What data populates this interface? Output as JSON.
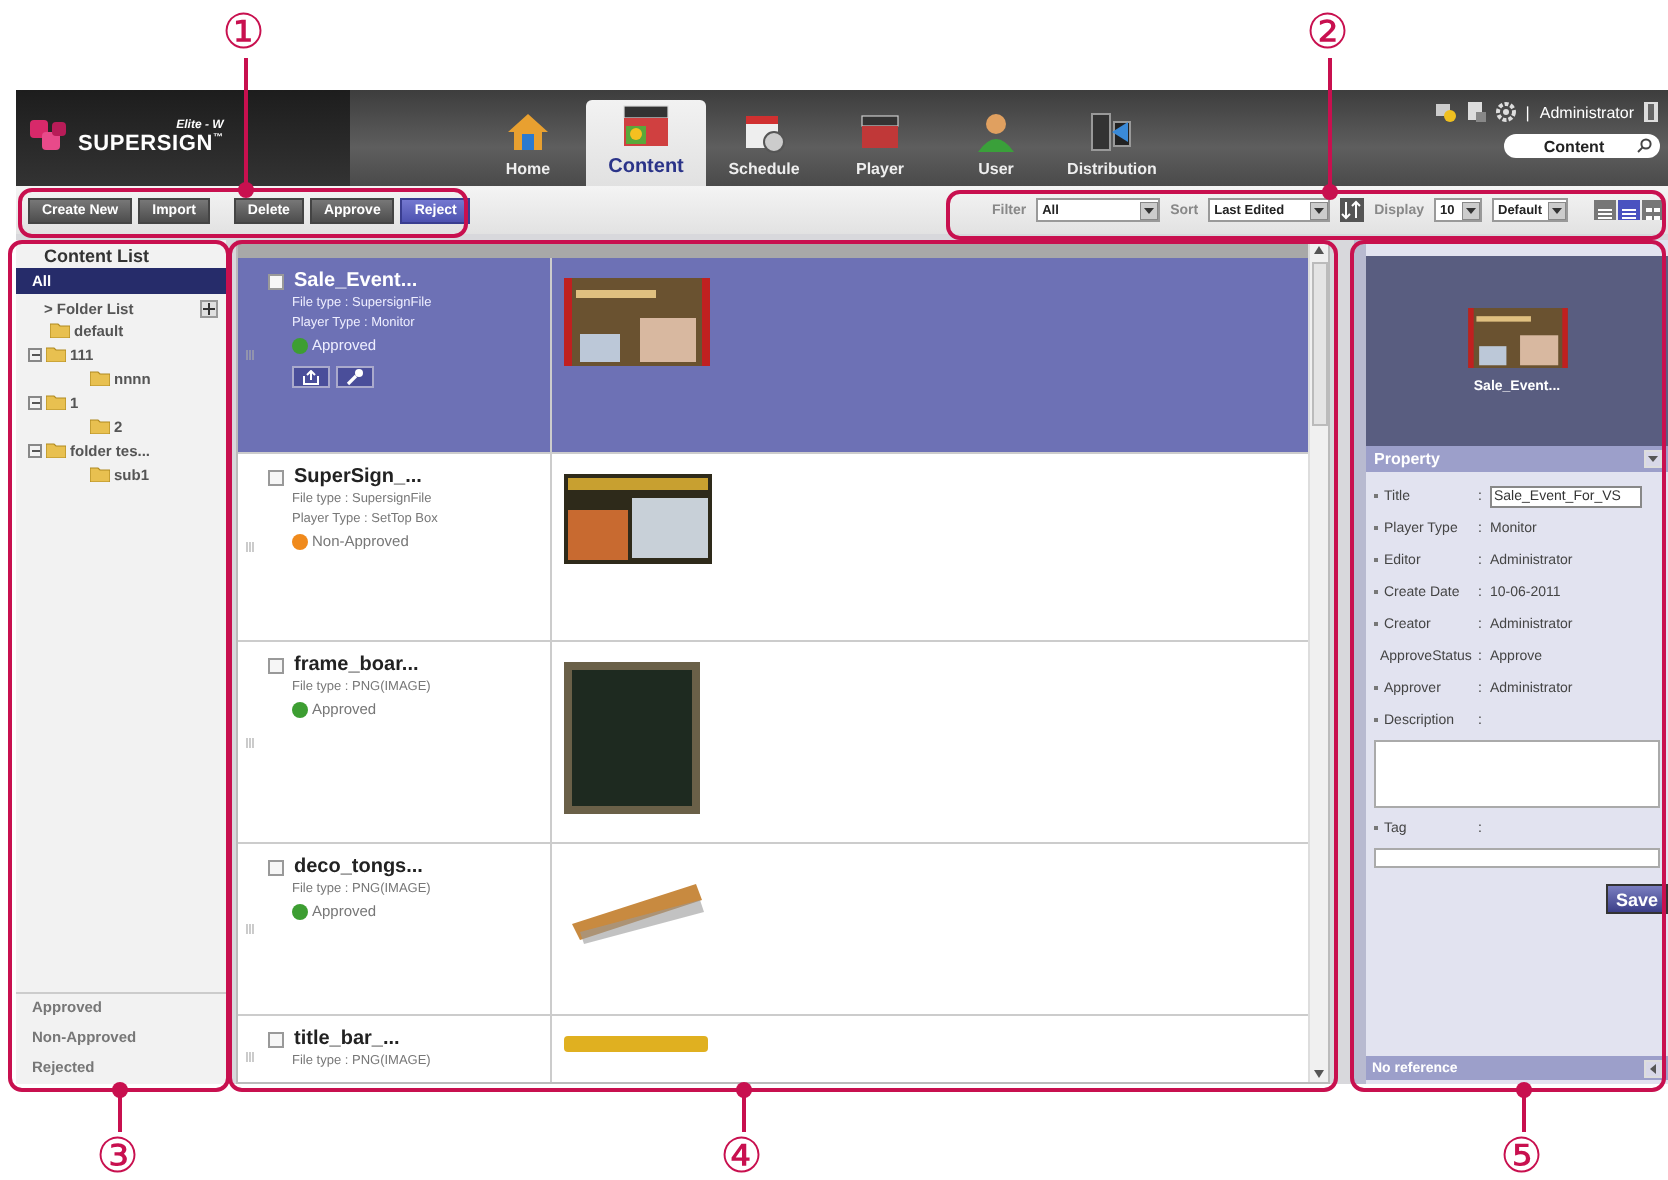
{
  "callouts": [
    "①",
    "②",
    "③",
    "④",
    "⑤"
  ],
  "header": {
    "logo": {
      "name": "SUPERSIGN",
      "trademark": "™",
      "edition": "Elite - W"
    },
    "nav_tabs": [
      {
        "label": "Home",
        "selected": false
      },
      {
        "label": "Content",
        "selected": true
      },
      {
        "label": "Schedule",
        "selected": false
      },
      {
        "label": "Player",
        "selected": false
      },
      {
        "label": "User",
        "selected": false
      },
      {
        "label": "Distribution",
        "selected": false
      }
    ],
    "divider": "|",
    "user": "Administrator",
    "search": {
      "value": "Content"
    }
  },
  "toolbar": {
    "groups": [
      [
        {
          "label": "Create New",
          "highlighted": false
        },
        {
          "label": "Import",
          "highlighted": false
        }
      ],
      [
        {
          "label": "Delete",
          "highlighted": false
        },
        {
          "label": "Approve",
          "highlighted": false
        },
        {
          "label": "Reject",
          "highlighted": true
        }
      ]
    ],
    "filter": {
      "label": "Filter",
      "value": "All"
    },
    "sort": {
      "label": "Sort",
      "value": "Last Edited"
    },
    "display": {
      "label": "Display",
      "count": "10",
      "layout": "Default"
    },
    "view_modes": [
      {
        "selected": false
      },
      {
        "selected": true
      },
      {
        "selected": false
      }
    ]
  },
  "sidebar": {
    "title": "Content List",
    "all": {
      "label": "All",
      "selected": true
    },
    "folder_list": {
      "marker": ">",
      "label": "Folder List"
    },
    "folders": [
      {
        "label": "default"
      },
      {
        "label": "111",
        "expanded": true,
        "children": [
          {
            "label": "nnnn"
          }
        ]
      },
      {
        "label": "1",
        "expanded": true,
        "children": [
          {
            "label": "2"
          }
        ]
      },
      {
        "label": "folder tes...",
        "expanded": true,
        "children": [
          {
            "label": "sub1"
          }
        ]
      }
    ],
    "status_filters": [
      "Approved",
      "Non-Approved",
      "Rejected"
    ]
  },
  "content_list": {
    "rows": [
      {
        "name": "Sale_Event...",
        "file_type": "File type : SupersignFile",
        "player_type": "Player Type : Monitor",
        "status": "Approved",
        "color": "#3d9e32",
        "selected": true,
        "checked": false
      },
      {
        "name": "SuperSign_...",
        "file_type": "File type : SupersignFile",
        "player_type": "Player Type : SetTop Box",
        "status": "Non-Approved",
        "color": "#f08a1c",
        "selected": false,
        "checked": false
      },
      {
        "name": "frame_boar...",
        "file_type": "File type : PNG(IMAGE)",
        "status": "Approved",
        "color": "#3d9e32",
        "selected": false,
        "checked": false
      },
      {
        "name": "deco_tongs...",
        "file_type": "File type : PNG(IMAGE)",
        "status": "Approved",
        "color": "#3d9e32",
        "selected": false,
        "checked": false
      },
      {
        "name": "title_bar_...",
        "file_type": "File type : PNG(IMAGE)",
        "selected": false,
        "checked": false
      }
    ]
  },
  "properties": {
    "preview_caption": "Sale_Event...",
    "header": "Property",
    "fields": [
      {
        "label": "Title",
        "separator": ":",
        "kind": "input",
        "value": "Sale_Event_For_VS"
      },
      {
        "label": "Player Type",
        "separator": ":",
        "kind": "text",
        "value": "Monitor"
      },
      {
        "label": "Editor",
        "separator": ":",
        "kind": "text",
        "value": "Administrator"
      },
      {
        "label": "Create Date",
        "separator": ":",
        "kind": "text",
        "value": "10-06-2011"
      },
      {
        "label": "Creator",
        "separator": ":",
        "kind": "text",
        "value": "Administrator"
      },
      {
        "label": "ApproveStatus",
        "separator": ":",
        "kind": "text",
        "value": "Approve"
      },
      {
        "label": "Approver",
        "separator": ":",
        "kind": "text",
        "value": "Administrator"
      },
      {
        "label": "Description",
        "separator": ":",
        "kind": "textarea"
      },
      {
        "label": "Tag",
        "separator": ":",
        "kind": "line"
      }
    ],
    "save": "Save",
    "footer": "No reference"
  }
}
